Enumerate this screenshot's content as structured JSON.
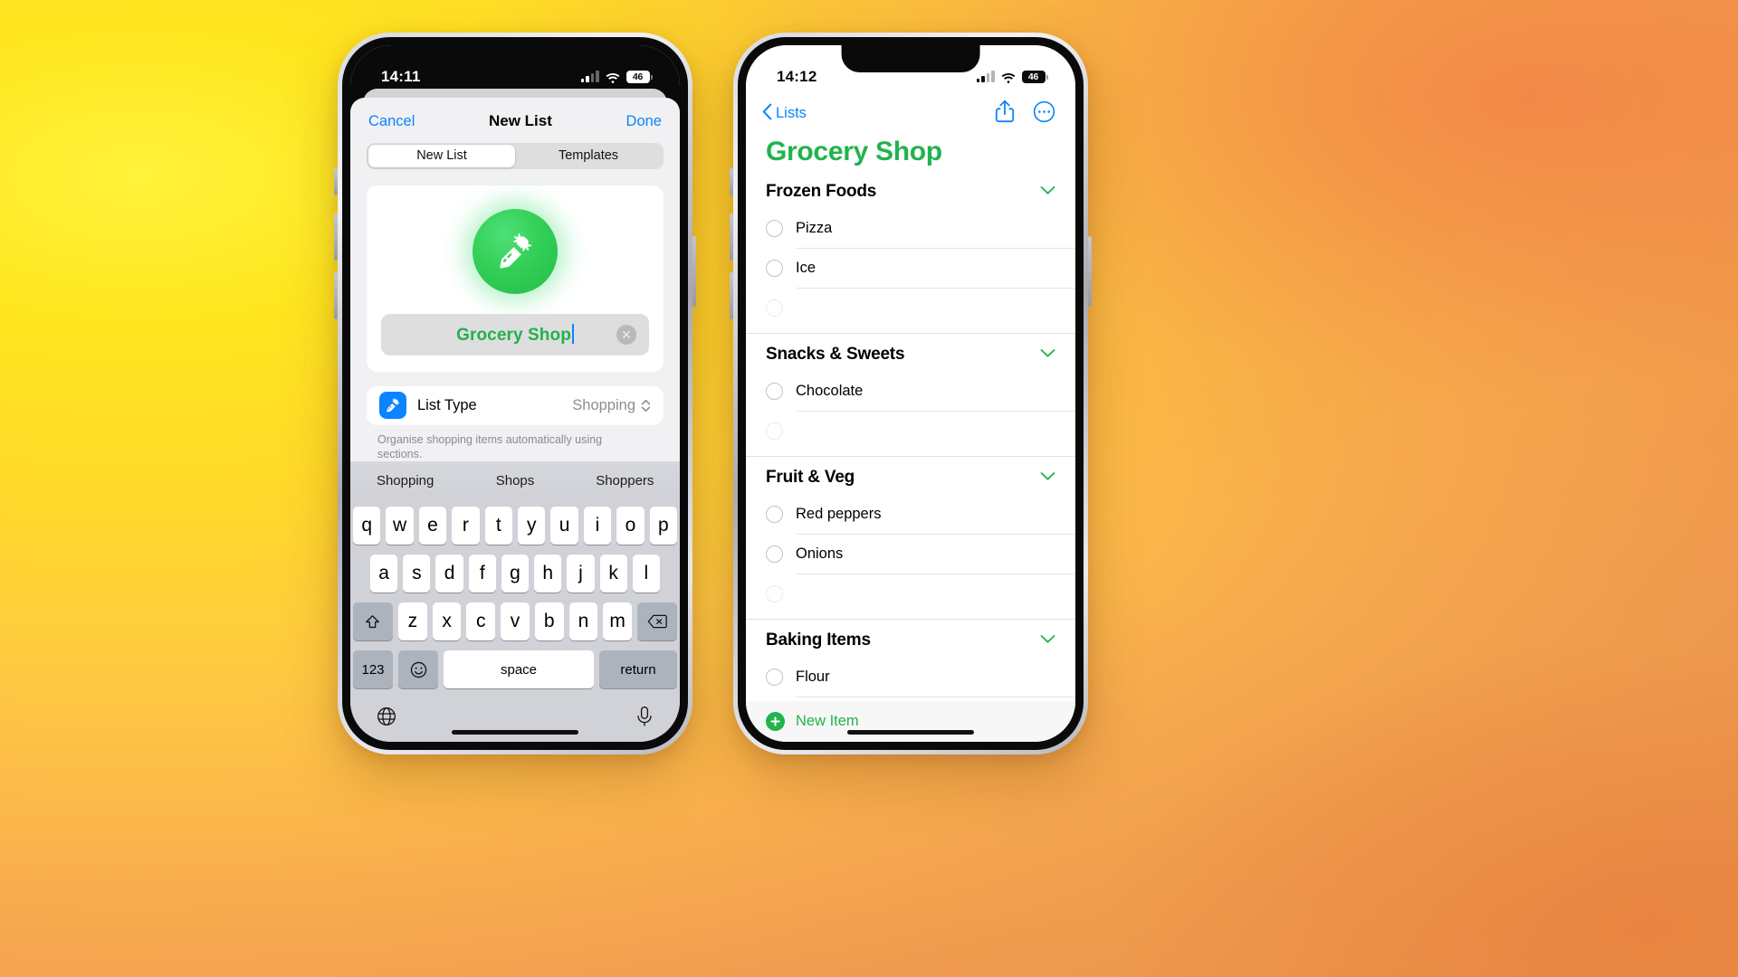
{
  "background": {
    "gradient_from": "#ffee3a",
    "gradient_to": "#e8854a"
  },
  "accent_colors": {
    "green": "#21b34e",
    "blue": "#0a84ff",
    "gray": "#8e8e93"
  },
  "left_phone": {
    "status_bar": {
      "time": "14:11",
      "battery": "46",
      "signal_icon": "cellular-bars-icon",
      "wifi_icon": "wifi-icon"
    },
    "sheet": {
      "cancel_label": "Cancel",
      "title": "New List",
      "done_label": "Done",
      "segments": [
        {
          "label": "New List",
          "selected": true
        },
        {
          "label": "Templates",
          "selected": false
        }
      ],
      "list_icon_name": "carrot-icon",
      "name_value": "Grocery Shop",
      "clear_icon": "clear-circle-icon",
      "list_type_row": {
        "icon": "carrot-icon",
        "label": "List Type",
        "value": "Shopping",
        "chevron": "chevron-up-down-icon"
      },
      "footnote": "Organise shopping items automatically using sections."
    },
    "keyboard": {
      "predictions": [
        "Shopping",
        "Shops",
        "Shoppers"
      ],
      "row1": [
        "q",
        "w",
        "e",
        "r",
        "t",
        "y",
        "u",
        "i",
        "o",
        "p"
      ],
      "row2": [
        "a",
        "s",
        "d",
        "f",
        "g",
        "h",
        "j",
        "k",
        "l"
      ],
      "row3": [
        "z",
        "x",
        "c",
        "v",
        "b",
        "n",
        "m"
      ],
      "shift_icon": "shift-icon",
      "backspace_icon": "backspace-icon",
      "numbers_label": "123",
      "emoji_icon": "emoji-icon",
      "space_label": "space",
      "return_label": "return",
      "globe_icon": "globe-icon",
      "mic_icon": "microphone-icon"
    }
  },
  "right_phone": {
    "status_bar": {
      "time": "14:12",
      "battery": "46",
      "signal_icon": "cellular-bars-icon",
      "wifi_icon": "wifi-icon"
    },
    "nav": {
      "back_label": "Lists",
      "back_icon": "chevron-left-icon",
      "share_icon": "share-icon",
      "more_icon": "more-circle-icon"
    },
    "title": "Grocery Shop",
    "sections": [
      {
        "title": "Frozen Foods",
        "collapse_icon": "chevron-down-icon",
        "items": [
          "Pizza",
          "Ice"
        ],
        "has_placeholder": true
      },
      {
        "title": "Snacks & Sweets",
        "collapse_icon": "chevron-down-icon",
        "items": [
          "Chocolate"
        ],
        "has_placeholder": true
      },
      {
        "title": "Fruit & Veg",
        "collapse_icon": "chevron-down-icon",
        "items": [
          "Red peppers",
          "Onions"
        ],
        "has_placeholder": true
      },
      {
        "title": "Baking Items",
        "collapse_icon": "chevron-down-icon",
        "items": [
          "Flour"
        ],
        "has_placeholder": false
      }
    ],
    "new_item": {
      "label": "New Item",
      "icon": "plus-circle-icon"
    }
  }
}
